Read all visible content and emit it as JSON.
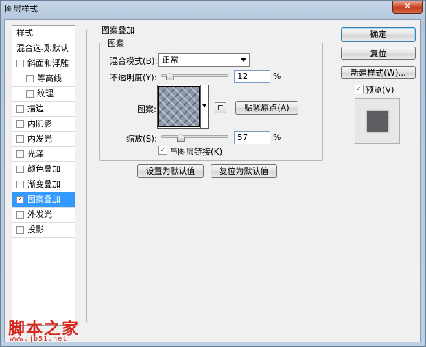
{
  "window": {
    "title": "图层样式",
    "close_label": "✕"
  },
  "style_list": {
    "items": [
      {
        "label": "样式",
        "kind": "header",
        "indent": 0
      },
      {
        "label": "混合选项:默认",
        "kind": "header",
        "indent": 0
      },
      {
        "label": "斜面和浮雕",
        "kind": "check",
        "checked": false,
        "indent": 0
      },
      {
        "label": "等高线",
        "kind": "check",
        "checked": false,
        "indent": 1
      },
      {
        "label": "纹理",
        "kind": "check",
        "checked": false,
        "indent": 1
      },
      {
        "label": "描边",
        "kind": "check",
        "checked": false,
        "indent": 0
      },
      {
        "label": "内阴影",
        "kind": "check",
        "checked": false,
        "indent": 0
      },
      {
        "label": "内发光",
        "kind": "check",
        "checked": false,
        "indent": 0
      },
      {
        "label": "光泽",
        "kind": "check",
        "checked": false,
        "indent": 0
      },
      {
        "label": "颜色叠加",
        "kind": "check",
        "checked": false,
        "indent": 0
      },
      {
        "label": "渐变叠加",
        "kind": "check",
        "checked": false,
        "indent": 0
      },
      {
        "label": "图案叠加",
        "kind": "check",
        "checked": true,
        "indent": 0,
        "selected": true
      },
      {
        "label": "外发光",
        "kind": "check",
        "checked": false,
        "indent": 0
      },
      {
        "label": "投影",
        "kind": "check",
        "checked": false,
        "indent": 0
      }
    ]
  },
  "panel": {
    "outer_title": "图案叠加",
    "inner_title": "图案",
    "blend_mode_label": "混合模式(B):",
    "blend_mode_value": "正常",
    "opacity_label": "不透明度(Y):",
    "opacity_value": "12",
    "opacity_fraction": 0.12,
    "percent": "%",
    "pattern_label": "图案:",
    "snap_button": "贴紧原点(A)",
    "scale_label": "缩放(S):",
    "scale_value": "57",
    "scale_fraction": 0.57,
    "link_label": "与图层链接(K)",
    "link_checked": true,
    "checkmark": "✓",
    "set_default": "设置为默认值",
    "reset_default": "复位为默认值"
  },
  "actions": {
    "ok": "确定",
    "reset": "复位",
    "new_style": "新建样式(W)...",
    "preview_label": "预览(V)",
    "preview_checked": true
  },
  "watermark": {
    "text": "脚本之家",
    "url": "www.jb51.net"
  },
  "colors": {
    "selection": "#3399ff",
    "watermark": "#d9261c"
  }
}
